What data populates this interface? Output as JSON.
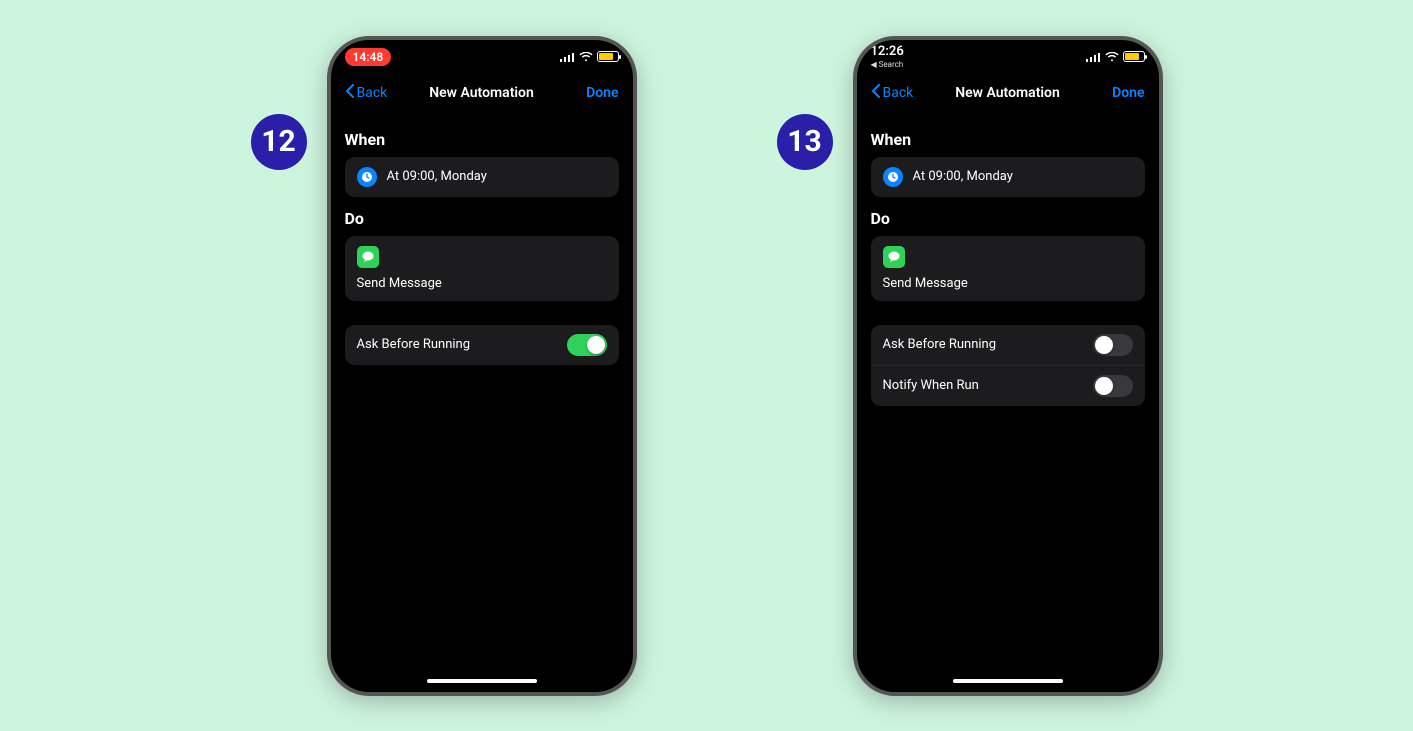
{
  "badges": {
    "left": "12",
    "right": "13"
  },
  "phone12": {
    "status": {
      "time": "14:48",
      "back_search": ""
    },
    "nav": {
      "back": "Back",
      "title": "New Automation",
      "done": "Done"
    },
    "sections": {
      "when_title": "When",
      "when_text": "At 09:00, Monday",
      "do_title": "Do",
      "do_text": "Send Message"
    },
    "options": [
      {
        "label": "Ask Before Running",
        "on": true
      }
    ]
  },
  "phone13": {
    "status": {
      "time": "12:26",
      "back_search": "◀ Search"
    },
    "nav": {
      "back": "Back",
      "title": "New Automation",
      "done": "Done"
    },
    "sections": {
      "when_title": "When",
      "when_text": "At 09:00, Monday",
      "do_title": "Do",
      "do_text": "Send Message"
    },
    "options": [
      {
        "label": "Ask Before Running",
        "on": false
      },
      {
        "label": "Notify When Run",
        "on": false
      }
    ]
  }
}
